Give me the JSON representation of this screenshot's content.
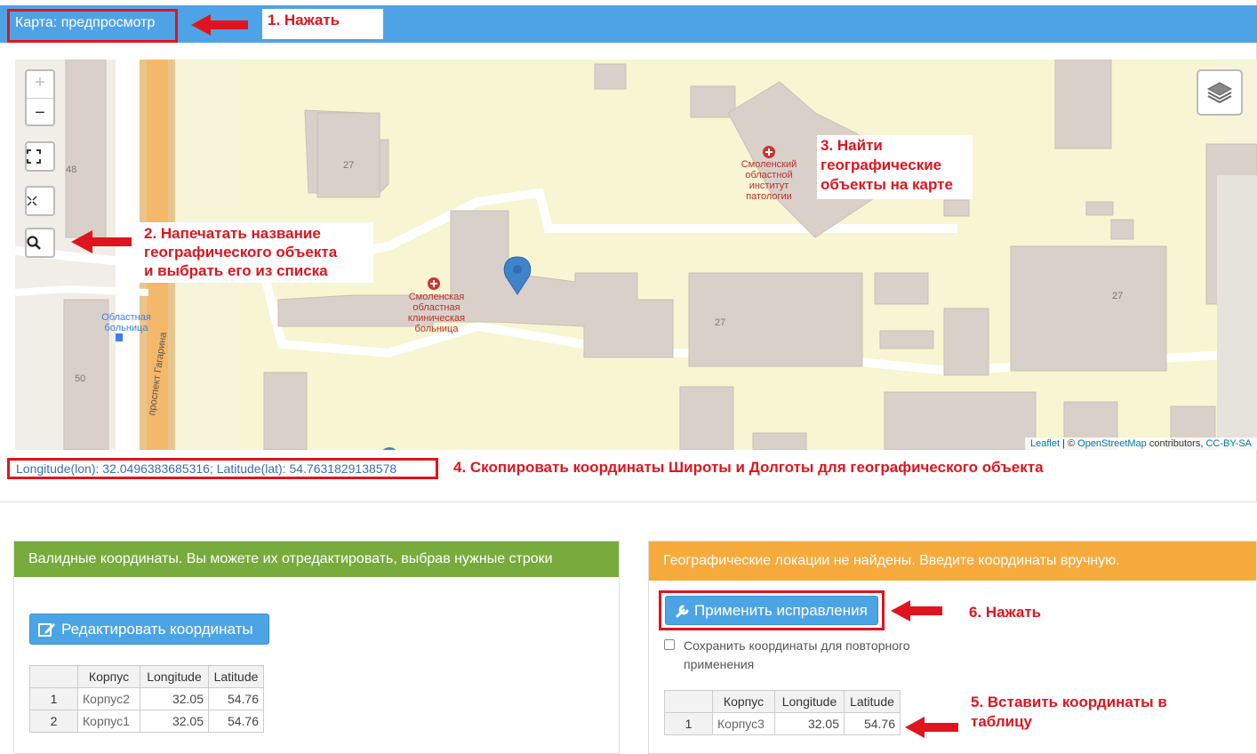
{
  "header": {
    "title": "Карта: предпросмотр"
  },
  "steps": {
    "step1": "1. Нажать",
    "step2_line1": "2. Напечатать название",
    "step2_line2": "географического объекта",
    "step2_line3": "и выбрать его из списка",
    "step3_line1": "3. Найти",
    "step3_line2": "географические",
    "step3_line3": "объекты на карте",
    "step4": "4. Скопировать координаты Широты и Долготы для географического объекта",
    "step5_line1": "5. Вставить координаты в",
    "step5_line2": "таблицу",
    "step6": "6. Нажать"
  },
  "map": {
    "controls": {
      "zoom_in": "+",
      "zoom_out": "−"
    },
    "labels": {
      "institute": [
        "Смоленский",
        "областной",
        "институт",
        "патологии"
      ],
      "hospital": [
        "Смоленская",
        "областная",
        "клиническая",
        "больница"
      ],
      "bus_stop": [
        "Областная",
        "больница"
      ],
      "street": "проспект Гагарина",
      "num_48": "48",
      "num_27a": "27",
      "num_27b": "27",
      "num_27c": "27",
      "num_50": "50"
    },
    "attribution": {
      "leaflet": "Leaflet",
      "sep": " | © ",
      "osm": "OpenStreetMap",
      "contrib": " contributors, ",
      "license": "CC-BY-SA"
    }
  },
  "coordinates_text": "Longitude(lon): 32.0496383685316; Latitude(lat): 54.7631829138578",
  "left_panel": {
    "heading": "Валидные координаты. Вы можете их отредактировать, выбрав нужные строки",
    "edit_button": "Редактировать координаты",
    "columns": [
      "Корпус",
      "Longitude",
      "Latitude"
    ],
    "rows": [
      {
        "n": "1",
        "name": "Корпус2",
        "lon": "32.05",
        "lat": "54.76"
      },
      {
        "n": "2",
        "name": "Корпус1",
        "lon": "32.05",
        "lat": "54.76"
      }
    ]
  },
  "right_panel": {
    "heading": "Географические локации не найдены. Введите координаты вручную.",
    "apply_button": "Применить исправления",
    "save_checkbox_line1": "Сохранить координаты для повторного",
    "save_checkbox_line2": "применения",
    "columns": [
      "Корпус",
      "Longitude",
      "Latitude"
    ],
    "rows": [
      {
        "n": "1",
        "name": "Корпус3",
        "lon": "32.05",
        "lat": "54.76"
      }
    ]
  },
  "colors": {
    "header_blue": "#4ea3e6",
    "annotation_red": "#e0141e",
    "panel_green": "#77ab3c",
    "panel_orange": "#f7aa3c",
    "button_blue": "#4da4e5",
    "map_bg": "#f8f4d9",
    "building": "#d9d0c9"
  }
}
